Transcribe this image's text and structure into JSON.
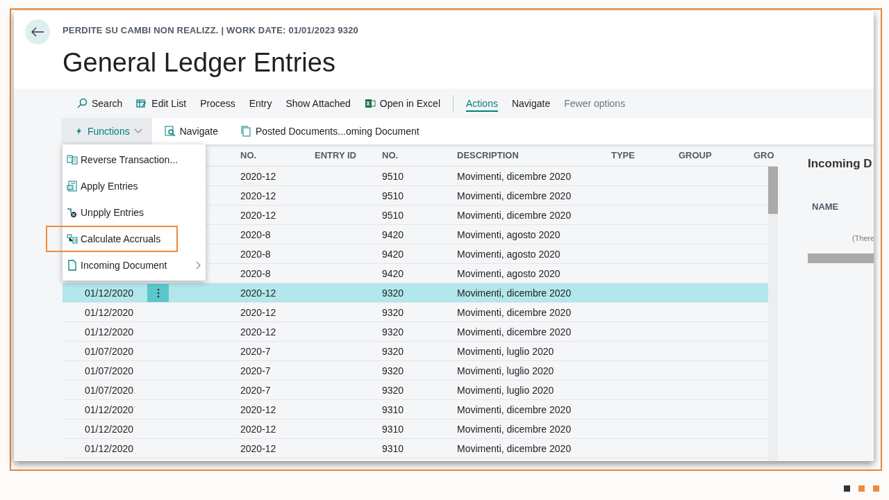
{
  "page": {
    "caption": "PERDITE SU CAMBI NON REALIZZ. | WORK DATE: 01/01/2023 9320",
    "title": "General Ledger Entries"
  },
  "toolbar": [
    {
      "label": "Search",
      "kind": "action"
    },
    {
      "label": "Edit List",
      "kind": "action"
    },
    {
      "label": "Process",
      "kind": "action"
    },
    {
      "label": "Entry",
      "kind": "action"
    },
    {
      "label": "Show Attached",
      "kind": "action"
    },
    {
      "label": "Open in Excel",
      "kind": "action"
    },
    {
      "label": "Actions",
      "kind": "tab",
      "selected": true
    },
    {
      "label": "Navigate",
      "kind": "tab",
      "selected": false
    },
    {
      "label": "Fewer options",
      "kind": "link"
    }
  ],
  "action_bar": [
    {
      "label": "Functions",
      "expanded": true
    },
    {
      "label": "Navigate",
      "expanded": false
    },
    {
      "label": "Posted Documents...oming Document",
      "expanded": false
    }
  ],
  "functions_menu": [
    {
      "label": "Reverse Transaction...",
      "highlighted": false,
      "submenu": false
    },
    {
      "label": "Apply Entries",
      "highlighted": false,
      "submenu": false
    },
    {
      "label": "Unpply Entries",
      "highlighted": false,
      "submenu": false
    },
    {
      "label": "Calculate Accruals",
      "highlighted": true,
      "submenu": false
    },
    {
      "label": "Incoming Document",
      "highlighted": false,
      "submenu": true
    }
  ],
  "table": {
    "columns": [
      {
        "label": "NO."
      },
      {
        "label": "ENTRY ID"
      },
      {
        "label": "NO."
      },
      {
        "label": "DESCRIPTION"
      },
      {
        "label": "TYPE"
      },
      {
        "label": "GROUP"
      },
      {
        "label": "GRO"
      }
    ],
    "rows": [
      {
        "document_no": "2020-12",
        "account_no": "9510",
        "description": "Movimenti, dicembre 2020",
        "selected": false
      },
      {
        "document_no": "2020-12",
        "account_no": "9510",
        "description": "Movimenti, dicembre 2020",
        "selected": false
      },
      {
        "document_no": "2020-12",
        "account_no": "9510",
        "description": "Movimenti, dicembre 2020",
        "selected": false
      },
      {
        "document_no": "2020-8",
        "account_no": "9420",
        "description": "Movimenti, agosto 2020",
        "selected": false
      },
      {
        "document_no": "2020-8",
        "account_no": "9420",
        "description": "Movimenti, agosto 2020",
        "selected": false
      },
      {
        "document_no": "2020-8",
        "account_no": "9420",
        "description": "Movimenti, agosto 2020",
        "selected": false
      },
      {
        "date": "01/12/2020",
        "document_no": "2020-12",
        "account_no": "9320",
        "description": "Movimenti, dicembre 2020",
        "selected": true
      },
      {
        "date": "01/12/2020",
        "document_no": "2020-12",
        "account_no": "9320",
        "description": "Movimenti, dicembre 2020",
        "selected": false
      },
      {
        "date": "01/12/2020",
        "document_no": "2020-12",
        "account_no": "9320",
        "description": "Movimenti, dicembre 2020",
        "selected": false
      },
      {
        "date": "01/07/2020",
        "document_no": "2020-7",
        "account_no": "9320",
        "description": "Movimenti, luglio 2020",
        "selected": false
      },
      {
        "date": "01/07/2020",
        "document_no": "2020-7",
        "account_no": "9320",
        "description": "Movimenti, luglio 2020",
        "selected": false
      },
      {
        "date": "01/07/2020",
        "document_no": "2020-7",
        "account_no": "9320",
        "description": "Movimenti, luglio 2020",
        "selected": false
      },
      {
        "date": "01/12/2020",
        "document_no": "2020-12",
        "account_no": "9310",
        "description": "Movimenti, dicembre 2020",
        "selected": false
      },
      {
        "date": "01/12/2020",
        "document_no": "2020-12",
        "account_no": "9310",
        "description": "Movimenti, dicembre 2020",
        "selected": false
      },
      {
        "date": "01/12/2020",
        "document_no": "2020-12",
        "account_no": "9310",
        "description": "Movimenti, dicembre 2020",
        "selected": false
      }
    ]
  },
  "factbox": {
    "title": "Incoming D",
    "column": "NAME",
    "empty_text": "(There"
  }
}
